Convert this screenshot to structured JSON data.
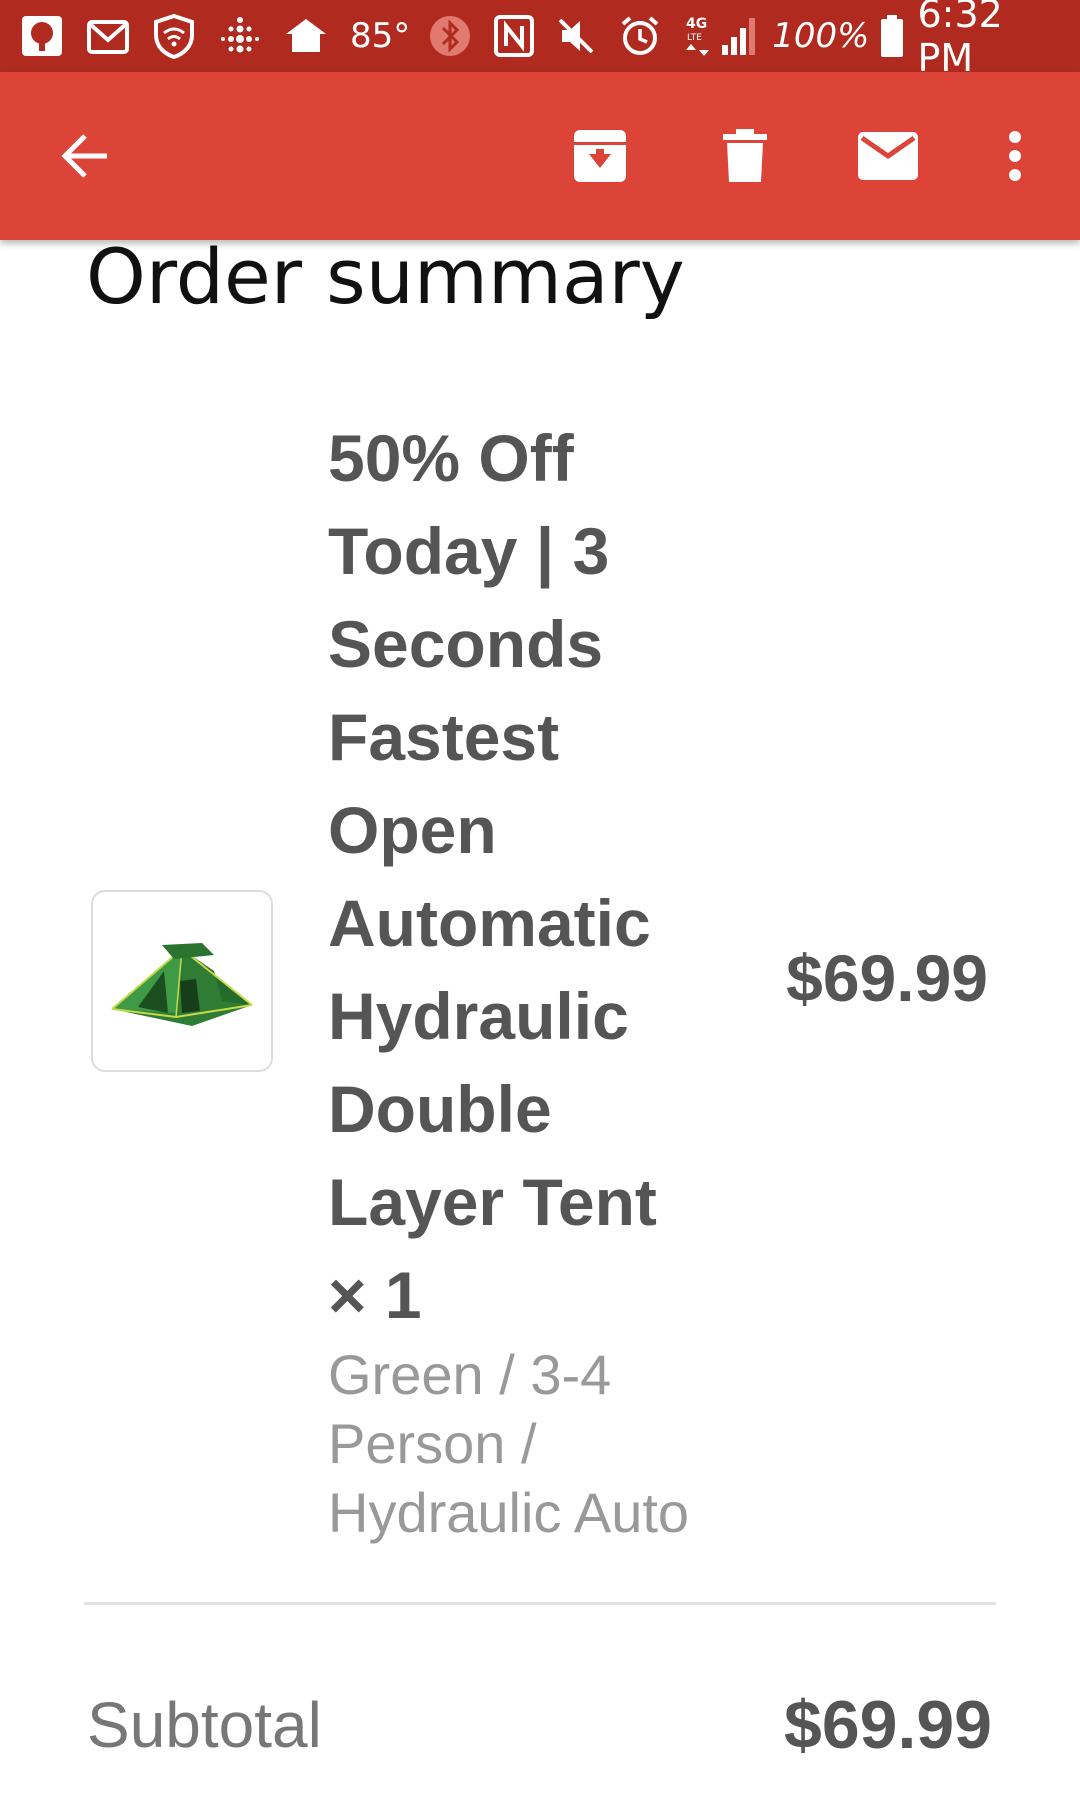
{
  "status_bar": {
    "temperature": "85°",
    "battery": "100%",
    "time": "6:32 PM",
    "network": "4G LTE",
    "icons": [
      "notification-icon",
      "gmail-icon",
      "vpn-shield-icon",
      "fitbit-icon",
      "home-icon",
      "bluetooth-icon",
      "nfc-icon",
      "mute-icon",
      "alarm-icon",
      "signal-icon",
      "battery-icon"
    ]
  },
  "toolbar": {
    "color": "#db4437",
    "actions": [
      "back-icon",
      "archive-icon",
      "delete-icon",
      "mark-unread-icon",
      "more-options-icon"
    ]
  },
  "order": {
    "heading": "Order summary",
    "item": {
      "title": "50% Off Today | 3 Seconds Fastest Open Automatic Hydraulic Double Layer Tent × 1",
      "variant": "Green / 3-4 Person / Hydraulic Auto",
      "price": "$69.99",
      "image": "green-tent-image"
    },
    "subtotal_label": "Subtotal",
    "subtotal_value": "$69.99"
  }
}
